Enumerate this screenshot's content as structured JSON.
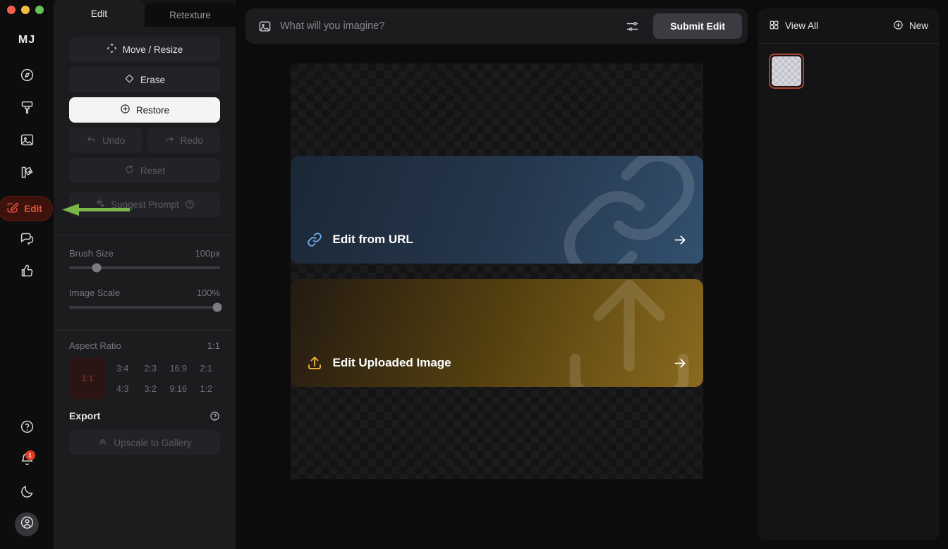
{
  "window": {
    "controls": [
      "close",
      "minimize",
      "maximize"
    ]
  },
  "rail": {
    "logo": "MJ",
    "items": [
      {
        "icon": "compass-icon",
        "name": "explore"
      },
      {
        "icon": "paintbrush-icon",
        "name": "create"
      },
      {
        "icon": "image-icon",
        "name": "organize"
      },
      {
        "icon": "palette-icon",
        "name": "personalize"
      }
    ],
    "active": {
      "label": "Edit",
      "icon": "edit-square-icon"
    },
    "after": [
      {
        "icon": "chat-icon",
        "name": "chat"
      },
      {
        "icon": "thumbs-up-icon",
        "name": "rate"
      }
    ],
    "bottom": [
      {
        "icon": "help-circle-icon",
        "name": "help"
      },
      {
        "icon": "bell-icon",
        "name": "notifications",
        "badge": "1"
      },
      {
        "icon": "moon-icon",
        "name": "theme"
      },
      {
        "icon": "account-icon",
        "name": "account"
      }
    ]
  },
  "panel": {
    "tabs": [
      {
        "label": "Edit",
        "active": true
      },
      {
        "label": "Retexture",
        "active": false
      }
    ],
    "tools": [
      {
        "label": "Move / Resize",
        "icon": "move-icon",
        "state": "normal"
      },
      {
        "label": "Erase",
        "icon": "eraser-icon",
        "state": "normal"
      },
      {
        "label": "Restore",
        "icon": "plus-circle-icon",
        "state": "active"
      }
    ],
    "history": [
      {
        "label": "Undo",
        "icon": "undo-icon",
        "state": "disabled"
      },
      {
        "label": "Redo",
        "icon": "redo-icon",
        "state": "disabled"
      }
    ],
    "reset": {
      "label": "Reset",
      "icon": "reset-icon",
      "state": "disabled"
    },
    "suggest": {
      "label": "Suggest Prompt",
      "icon": "sparkle-icon",
      "help": "help-circle-icon",
      "state": "disabled"
    },
    "sliders": [
      {
        "label": "Brush Size",
        "value": "100px",
        "percent": 18
      },
      {
        "label": "Image Scale",
        "value": "100%",
        "percent": 98
      }
    ],
    "aspect_ratio": {
      "label": "Aspect Ratio",
      "value": "1:1",
      "current": "1:1",
      "options": [
        "3:4",
        "2:3",
        "16:9",
        "2:1",
        "4:3",
        "3:2",
        "9:16",
        "1:2"
      ]
    },
    "export": {
      "title": "Export",
      "help": "help-circle-icon",
      "button": {
        "label": "Upscale to Gallery",
        "icon": "chevron-up-double-icon",
        "state": "disabled"
      }
    }
  },
  "prompt": {
    "image_icon": "image-icon",
    "placeholder": "What will you imagine?",
    "value": "",
    "settings_icon": "sliders-icon",
    "submit_label": "Submit Edit"
  },
  "canvas": {
    "cards": [
      {
        "label": "Edit from URL",
        "icon": "link-icon",
        "arrow": "arrow-right-icon",
        "accent": "#6fa8e0"
      },
      {
        "label": "Edit Uploaded Image",
        "icon": "upload-icon",
        "arrow": "arrow-right-icon",
        "accent": "#e9b340"
      }
    ]
  },
  "right_panel": {
    "view_all": {
      "label": "View All",
      "icon": "grid-icon"
    },
    "new": {
      "label": "New",
      "icon": "plus-circle-icon"
    },
    "thumbnails": [
      {
        "name": "empty-canvas",
        "selected": true
      }
    ]
  },
  "annotation": {
    "type": "arrow",
    "color": "#7ab648",
    "points_to": "sidebar-item-edit"
  }
}
